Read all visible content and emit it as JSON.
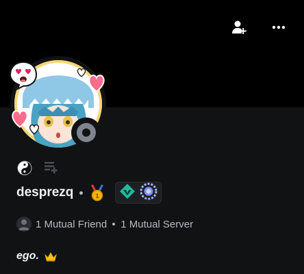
{
  "profile": {
    "username": "desprezq",
    "status": "offline",
    "bio": "ego."
  },
  "mutuals": {
    "friends": "1 Mutual Friend",
    "servers": "1 Mutual Server"
  },
  "icons": {
    "add_friend": "add-friend-icon",
    "more": "more-options-icon",
    "yin_yang": "yin-yang-icon",
    "note": "note-icon",
    "medal": "medal-icon",
    "nitro_badge": "hypesquad-badge-icon",
    "boost_badge": "server-boost-badge-icon",
    "crown": "crown-emoji"
  },
  "colors": {
    "banner": "#000000",
    "background": "#111214",
    "status_offline": "#80848e",
    "badge_teal": "#1fb99b",
    "badge_lavender": "#a5b4fc",
    "crown": "#f5c518"
  }
}
